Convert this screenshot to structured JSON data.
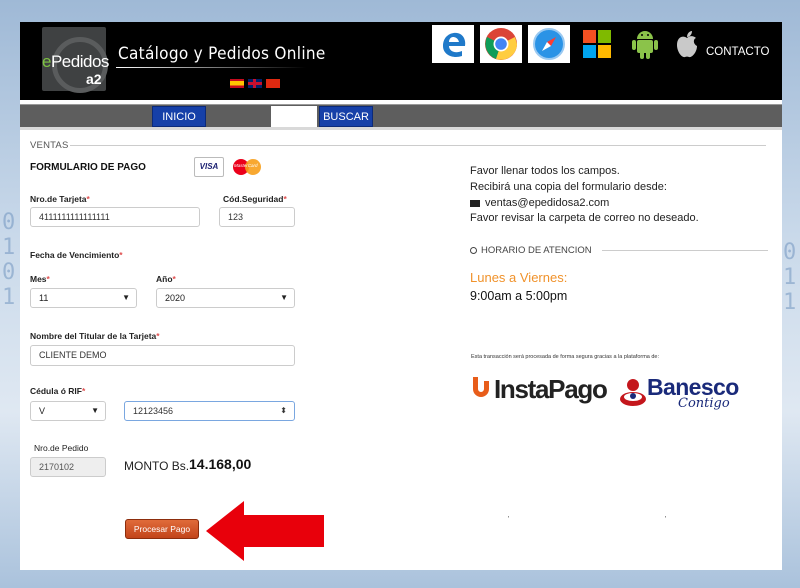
{
  "header": {
    "logo_text_e": "e",
    "logo_text_rest": "Pedidos",
    "logo_sub": "a2",
    "title": "Catálogo y Pedidos Online",
    "contact_label": "CONTACTO",
    "browser_icons": [
      "edge-icon",
      "chrome-icon",
      "safari-icon",
      "windows-icon",
      "android-icon",
      "apple-icon"
    ],
    "languages": [
      "es",
      "en",
      "cn"
    ]
  },
  "menubar": {
    "inicio_label": "INICIO",
    "search_value": "",
    "buscar_label": "BUSCAR"
  },
  "form": {
    "section_title": "VENTAS",
    "title": "FORMULARIO DE PAGO",
    "card_brands": [
      "VISA",
      "MasterCard"
    ],
    "card_number_label": "Nro.de Tarjeta",
    "card_number_value": "4111111111111111",
    "security_label": "Cód.Seguridad",
    "security_value": "123",
    "expiry_label": "Fecha de Vencimiento",
    "month_label": "Mes",
    "month_value": "11",
    "year_label": "Año",
    "year_value": "2020",
    "holder_label": "Nombre del Titular de la Tarjeta",
    "holder_value": "CLIENTE DEMO",
    "id_label": "Cédula ó RIF",
    "id_type_value": "V",
    "id_number_value": "12123456",
    "order_label": "Nro.de Pedido",
    "order_value": "2170102",
    "amount_label": "MONTO Bs.",
    "amount_value": "14.168,00",
    "submit_label": "Procesar Pago",
    "required_mark": "*"
  },
  "info": {
    "line1": "Favor llenar todos los campos.",
    "line2": "Recibirá una copia del formulario desde:",
    "email": "ventas@epedidosa2.com",
    "line4": "Favor revisar la carpeta de correo no deseado.",
    "hours_title": "HORARIO DE ATENCION",
    "days": "Lunes a Viernes:",
    "hours": "9:00am a 5:00pm",
    "processing_note": "Esta transacción será procesada de forma segura gracias a la plataforma de:",
    "instapago": "InstaPago",
    "banesco": "Banesco",
    "banesco_tag": "Contigo"
  },
  "colors": {
    "nav_blue": "#1640a8",
    "accent_orange": "#f0922b",
    "submit_button": "#c2441a",
    "arrow_red": "#e8000b"
  }
}
